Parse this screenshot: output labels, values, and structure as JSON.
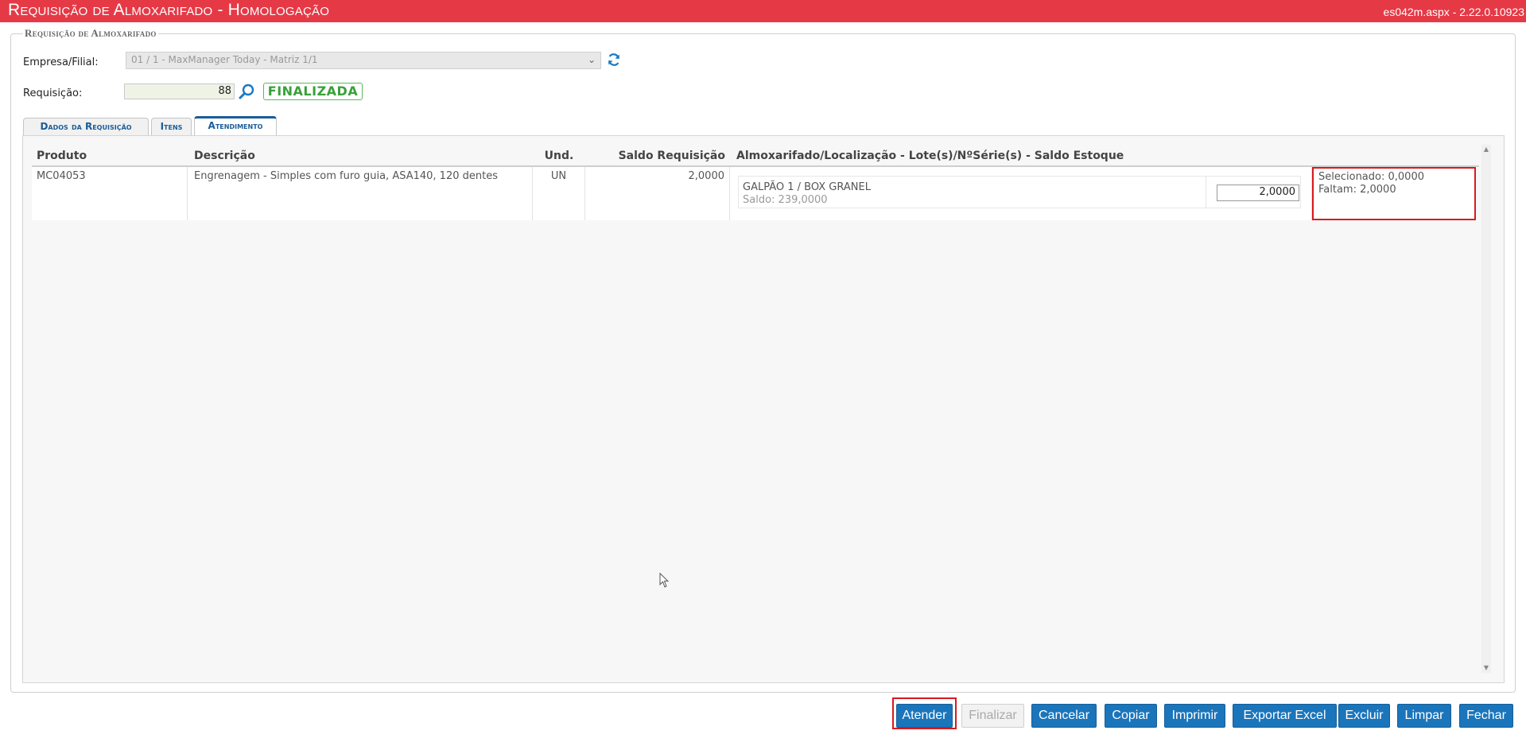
{
  "titlebar": {
    "title": "Requisição de Almoxarifado  - Homologação",
    "version": "es042m.aspx - 2.22.0.10923"
  },
  "form": {
    "legend": "Requisição de Almoxarifado",
    "empresa_label": "Empresa/Filial:",
    "empresa_value": "01 / 1 - MaxManager Today - Matriz 1/1",
    "requisicao_label": "Requisição:",
    "requisicao_value": "88",
    "status": "FINALIZADA"
  },
  "tabs": [
    {
      "label": "Dados da Requisição",
      "active": false
    },
    {
      "label": "Itens",
      "active": false
    },
    {
      "label": "Atendimento",
      "active": true
    }
  ],
  "grid": {
    "columns": [
      "Produto",
      "Descrição",
      "Und.",
      "Saldo Requisição",
      "Almoxarifado/Localização - Lote(s)/NºSérie(s) - Saldo Estoque"
    ],
    "rows": [
      {
        "produto": "MC04053",
        "descricao": "Engrenagem - Simples com furo guia, ASA140, 120 dentes",
        "und": "UN",
        "saldo_requisicao": "2,0000",
        "local": "GALPÃO 1 / BOX GRANEL",
        "saldo_estoque": "Saldo: 239,0000",
        "quantidade": "2,0000",
        "selecionado": "Selecionado: 0,0000",
        "faltam": "Faltam: 2,0000"
      }
    ]
  },
  "buttons": {
    "atender": "Atender",
    "finalizar": "Finalizar",
    "cancelar": "Cancelar",
    "copiar": "Copiar",
    "imprimir": "Imprimir",
    "exportar": "Exportar Excel",
    "excluir": "Excluir",
    "limpar": "Limpar",
    "fechar": "Fechar"
  },
  "colors": {
    "titlebar": "#e63946",
    "button": "#1b75bb",
    "status_green": "#3aa03a",
    "highlight_red": "#d9191e"
  },
  "icons": {
    "refresh": "refresh-icon",
    "search": "search-icon",
    "select_arrow": "chevron-down-icon"
  }
}
